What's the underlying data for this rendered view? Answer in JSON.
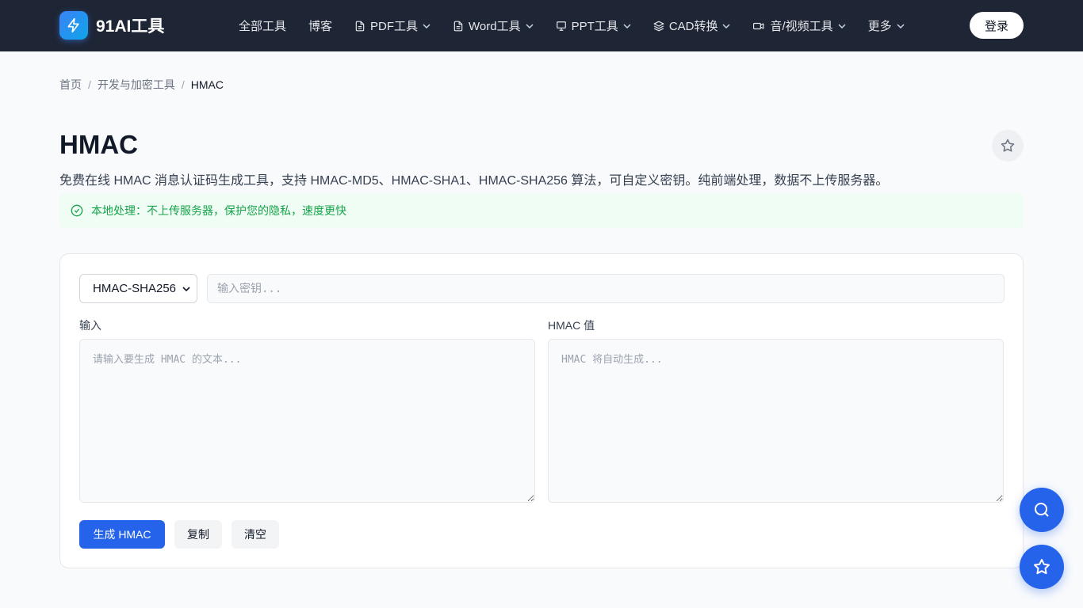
{
  "header": {
    "logo_text": "91AI工具",
    "nav": [
      {
        "label": "全部工具"
      },
      {
        "label": "博客"
      },
      {
        "label": "PDF工具"
      },
      {
        "label": "Word工具"
      },
      {
        "label": "PPT工具"
      },
      {
        "label": "CAD转换"
      },
      {
        "label": "音/视频工具"
      },
      {
        "label": "更多"
      }
    ],
    "login_label": "登录"
  },
  "breadcrumb": {
    "home": "首页",
    "category": "开发与加密工具",
    "current": "HMAC",
    "separator": "/"
  },
  "page": {
    "title": "HMAC",
    "description": "免费在线 HMAC 消息认证码生成工具，支持 HMAC-MD5、HMAC-SHA1、HMAC-SHA256 算法，可自定义密钥。纯前端处理，数据不上传服务器。",
    "notice": "本地处理：不上传服务器，保护您的隐私，速度更快"
  },
  "tool": {
    "algorithm_selected": "HMAC-SHA256",
    "key_placeholder": "输入密钥...",
    "input_label": "输入",
    "input_placeholder": "请输入要生成 HMAC 的文本...",
    "output_label": "HMAC 值",
    "output_placeholder": "HMAC 将自动生成...",
    "generate_label": "生成 HMAC",
    "copy_label": "复制",
    "clear_label": "清空"
  },
  "colors": {
    "header_bg": "#1e2535",
    "accent": "#2563eb",
    "notice_text": "#16a34a",
    "notice_bg": "#f0fdf4"
  }
}
